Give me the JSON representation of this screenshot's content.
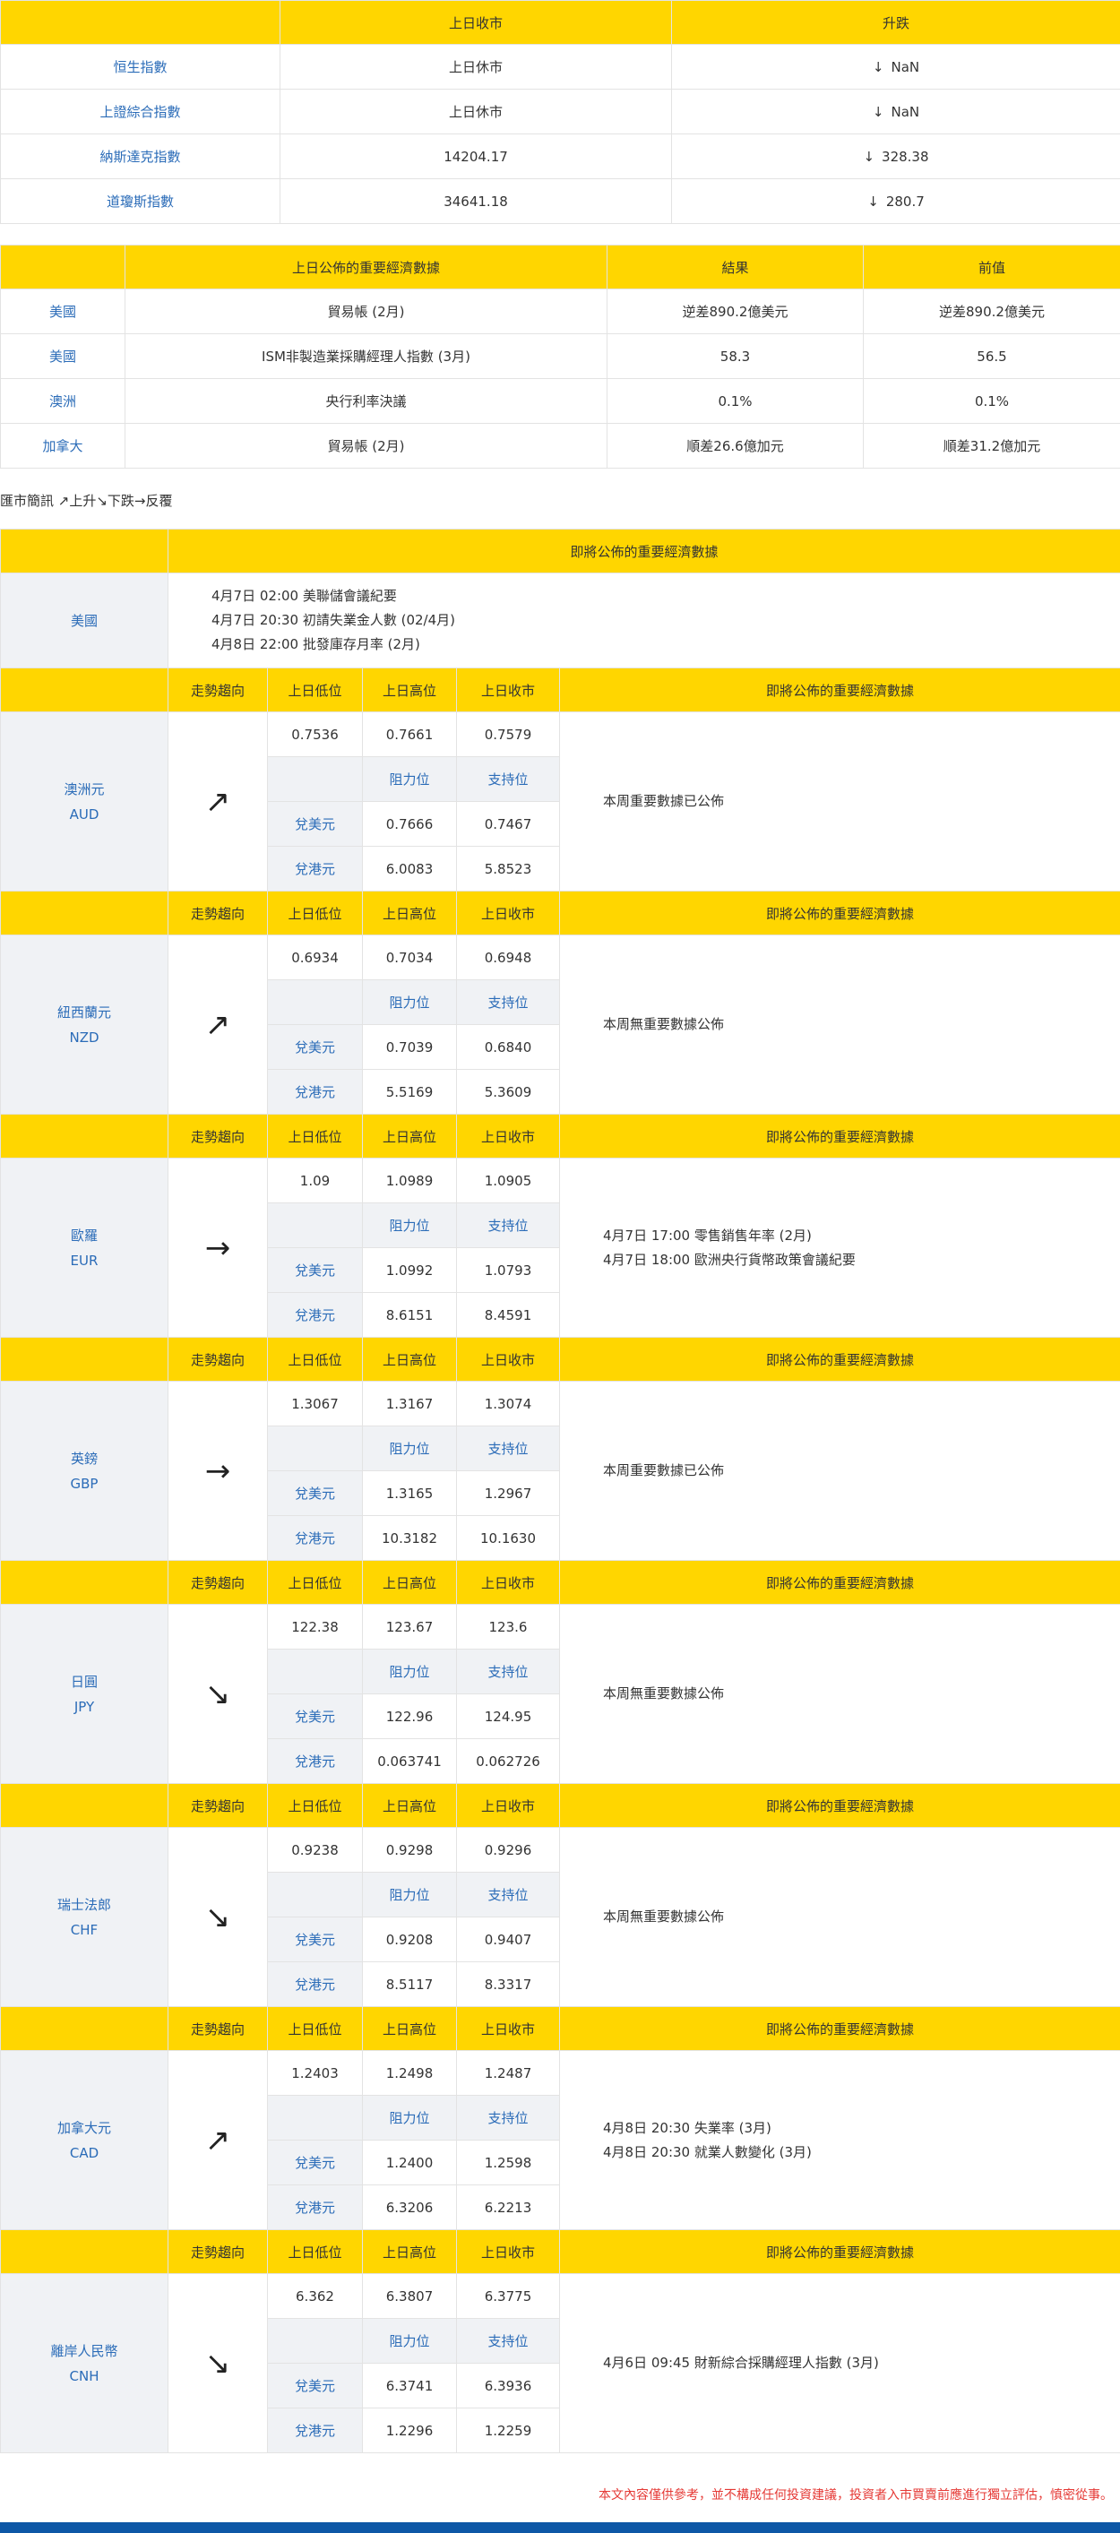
{
  "indices": {
    "headers": [
      "",
      "上日收市",
      "升跌"
    ],
    "rows": [
      {
        "name": "恒生指數",
        "close": "上日休市",
        "arrow": "↓",
        "change": "NaN"
      },
      {
        "name": "上證綜合指數",
        "close": "上日休市",
        "arrow": "↓",
        "change": "NaN"
      },
      {
        "name": "納斯達克指數",
        "close": "14204.17",
        "arrow": "↓",
        "change": "328.38"
      },
      {
        "name": "道瓊斯指數",
        "close": "34641.18",
        "arrow": "↓",
        "change": "280.7"
      }
    ]
  },
  "economic": {
    "headers": [
      "",
      "上日公佈的重要經濟數據",
      "結果",
      "前值"
    ],
    "rows": [
      {
        "country": "美國",
        "item": "貿易帳 (2月)",
        "result": "逆差890.2億美元",
        "previous": "逆差890.2億美元"
      },
      {
        "country": "美國",
        "item": "ISM非製造業採購經理人指數 (3月)",
        "result": "58.3",
        "previous": "56.5"
      },
      {
        "country": "澳洲",
        "item": "央行利率決議",
        "result": "0.1%",
        "previous": "0.1%"
      },
      {
        "country": "加拿大",
        "item": "貿易帳 (2月)",
        "result": "順差26.6億加元",
        "previous": "順差31.2億加元"
      }
    ]
  },
  "legend": "匯市簡訊 ↗上升↘下跌→反覆",
  "upcoming": {
    "header": "即將公佈的重要經濟數據",
    "country": "美國",
    "lines": [
      "4月7日 02:00 美聯儲會議紀要",
      "4月7日 20:30 初請失業金人數 (02/4月)",
      "4月8日 22:00 批發庫存月率 (2月)"
    ]
  },
  "currency_headers": {
    "trend": "走勢趨向",
    "low": "上日低位",
    "high": "上日高位",
    "close": "上日收市",
    "events": "即將公佈的重要經濟數據",
    "resistance": "阻力位",
    "support": "支持位",
    "vs_usd": "兌美元",
    "vs_hkd": "兌港元"
  },
  "currencies": [
    {
      "name_zh": "澳洲元",
      "code": "AUD",
      "trend": "↗",
      "low": "0.7536",
      "high": "0.7661",
      "close": "0.7579",
      "usd_res": "0.7666",
      "usd_sup": "0.7467",
      "hkd_res": "6.0083",
      "hkd_sup": "5.8523",
      "events": [
        "本周重要數據已公佈"
      ]
    },
    {
      "name_zh": "紐西蘭元",
      "code": "NZD",
      "trend": "↗",
      "low": "0.6934",
      "high": "0.7034",
      "close": "0.6948",
      "usd_res": "0.7039",
      "usd_sup": "0.6840",
      "hkd_res": "5.5169",
      "hkd_sup": "5.3609",
      "events": [
        "本周無重要數據公佈"
      ]
    },
    {
      "name_zh": "歐羅",
      "code": "EUR",
      "trend": "→",
      "low": "1.09",
      "high": "1.0989",
      "close": "1.0905",
      "usd_res": "1.0992",
      "usd_sup": "1.0793",
      "hkd_res": "8.6151",
      "hkd_sup": "8.4591",
      "events": [
        "4月7日 17:00 零售銷售年率 (2月)",
        "4月7日 18:00 歐洲央行貨幣政策會議紀要"
      ]
    },
    {
      "name_zh": "英鎊",
      "code": "GBP",
      "trend": "→",
      "low": "1.3067",
      "high": "1.3167",
      "close": "1.3074",
      "usd_res": "1.3165",
      "usd_sup": "1.2967",
      "hkd_res": "10.3182",
      "hkd_sup": "10.1630",
      "events": [
        "本周重要數據已公佈"
      ]
    },
    {
      "name_zh": "日圓",
      "code": "JPY",
      "trend": "↘",
      "low": "122.38",
      "high": "123.67",
      "close": "123.6",
      "usd_res": "122.96",
      "usd_sup": "124.95",
      "hkd_res": "0.063741",
      "hkd_sup": "0.062726",
      "events": [
        "本周無重要數據公佈"
      ]
    },
    {
      "name_zh": "瑞士法郎",
      "code": "CHF",
      "trend": "↘",
      "low": "0.9238",
      "high": "0.9298",
      "close": "0.9296",
      "usd_res": "0.9208",
      "usd_sup": "0.9407",
      "hkd_res": "8.5117",
      "hkd_sup": "8.3317",
      "events": [
        "本周無重要數據公佈"
      ]
    },
    {
      "name_zh": "加拿大元",
      "code": "CAD",
      "trend": "↗",
      "low": "1.2403",
      "high": "1.2498",
      "close": "1.2487",
      "usd_res": "1.2400",
      "usd_sup": "1.2598",
      "hkd_res": "6.3206",
      "hkd_sup": "6.2213",
      "events": [
        "4月8日 20:30 失業率 (3月)",
        "4月8日 20:30 就業人數變化 (3月)"
      ]
    },
    {
      "name_zh": "離岸人民幣",
      "code": "CNH",
      "trend": "↘",
      "low": "6.362",
      "high": "6.3807",
      "close": "6.3775",
      "usd_res": "6.3741",
      "usd_sup": "6.3936",
      "hkd_res": "1.2296",
      "hkd_sup": "1.2259",
      "events": [
        "4月6日 09:45 財新綜合採購經理人指數 (3月)"
      ]
    }
  ],
  "disclaimer": "本文內容僅供參考，並不構成任何投資建議，投資者入市買賣前應進行獨立評估，慎密從事。",
  "colors": {
    "header_yellow": "#ffd600",
    "label_blue": "#2b6cb8",
    "footer_blue": "#0d57a6",
    "disclaimer_red": "#e53935"
  }
}
